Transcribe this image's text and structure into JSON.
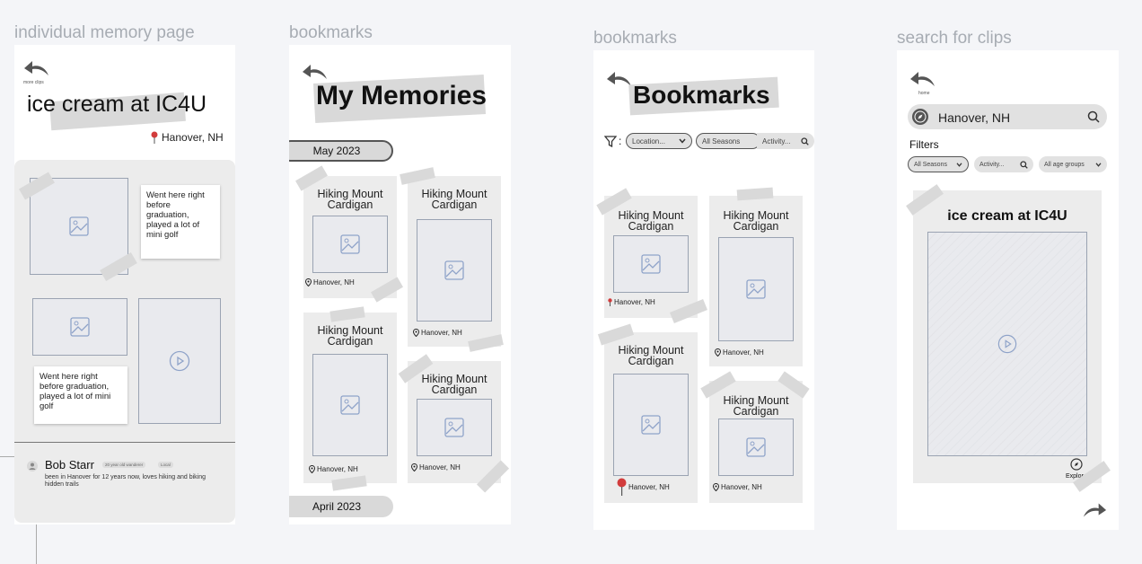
{
  "frames": {
    "individual": {
      "label": "individual memory page",
      "back_caption": "more clips",
      "title": "ice cream at IC4U",
      "location": "Hanover, NH",
      "note1": "Went here right before graduation, played a lot of mini golf",
      "note2": "Went here right before graduation, played a lot of mini golf",
      "user": {
        "name": "Bob Starr",
        "badges": [
          "20 year old wanderer",
          "Local"
        ],
        "bio": "been in Hanover for 12 years now, loves hiking and biking hidden trails"
      }
    },
    "memories": {
      "label": "bookmarks",
      "title": "My Memories",
      "months": [
        "May 2023",
        "April 2023"
      ],
      "cards": [
        {
          "title": "Hiking Mount Cardigan",
          "location": "Hanover, NH"
        },
        {
          "title": "Hiking Mount Cardigan",
          "location": "Hanover, NH"
        },
        {
          "title": "Hiking Mount Cardigan",
          "location": "Hanover, NH"
        },
        {
          "title": "Hiking Mount Cardigan",
          "location": "Hanover, NH"
        }
      ]
    },
    "bookmarks": {
      "label": "bookmarks",
      "title": "Bookmarks",
      "filter_sep": ":",
      "filters": [
        "Location...",
        "All Seasons",
        "Activity..."
      ],
      "cards": [
        {
          "title": "Hiking Mount Cardigan",
          "location": "Hanover, NH"
        },
        {
          "title": "Hiking Mount Cardigan",
          "location": "Hanover, NH"
        },
        {
          "title": "Hiking Mount Cardigan",
          "location": "Hanover, NH"
        },
        {
          "title": "Hiking Mount Cardigan",
          "location": "Hanover, NH"
        }
      ]
    },
    "search": {
      "label": "search for clips",
      "back_caption": "home",
      "search_value": "Hanover, NH",
      "filters_label": "Filters",
      "filters": [
        "All Seasons",
        "Activity...",
        "All age groups"
      ],
      "clip_title": "ice cream at IC4U",
      "explore_label": "Explore"
    }
  },
  "colors": {
    "background": "#f4f5f8",
    "tape": "#d9d9d9",
    "pin": "#d23c3c",
    "placeholder_stroke": "#9aa3b2"
  }
}
